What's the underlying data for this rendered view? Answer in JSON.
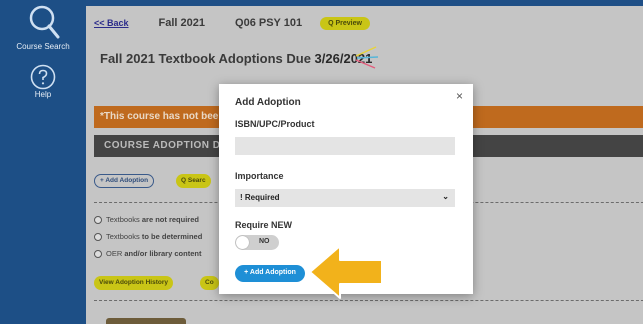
{
  "sidebar": {
    "items": [
      {
        "label": "Course Search",
        "icon": "search-icon"
      },
      {
        "label": "Help",
        "icon": "help-icon"
      }
    ]
  },
  "topbar": {
    "back": "<< Back",
    "term": "Fall 2021",
    "course": "Q06 PSY 101",
    "preview": "Q Preview"
  },
  "page": {
    "due_title": "Fall 2021 Textbook Adoptions Due ",
    "due_date": "3/26/2021",
    "warning": "*This course has not bee",
    "header": "COURSE ADOPTION DET",
    "add_adoption_btn": "+ Add Adoption",
    "search_btn": "Q Searc",
    "options": [
      {
        "lead": "Textbooks ",
        "strong": "are not required"
      },
      {
        "lead": "Textbooks ",
        "strong": "to be determined"
      },
      {
        "lead": "OER ",
        "strong": "and/or library content"
      }
    ],
    "view_history_btn": "View Adoption History",
    "extra_btn": "Co"
  },
  "modal": {
    "title": "Add Adoption",
    "isbn_label": "ISBN/UPC/Product",
    "isbn_value": "",
    "importance_label": "Importance",
    "importance_value": "! Required",
    "require_label": "Require ",
    "require_strong": "NEW",
    "toggle_text": "NO",
    "add_button": "+ Add Adoption",
    "close": "×"
  },
  "colors": {
    "sidebar": "#1d4f86",
    "warning": "#bf6a1e",
    "primary_button": "#1e8fd6",
    "accent_yellow": "#c9c516",
    "arrow": "#f2b21b"
  }
}
